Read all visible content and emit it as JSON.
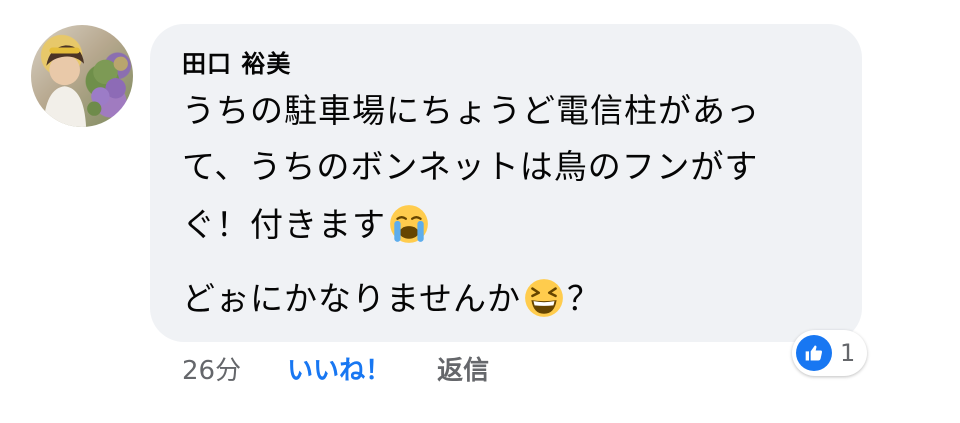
{
  "comment": {
    "author": "田口 裕美",
    "lines": {
      "l1": "うちの駐車場にちょうど電信柱があっ",
      "l2": "て、うちのボンネットは鳥のフンがす",
      "l3": "ぐ！付きます",
      "l4a": "どぉにかなりませんか",
      "l4b": "？"
    },
    "emoji_line3": "crying-face-emoji",
    "emoji_line4": "grinning-squinting-face-emoji",
    "time": "26分",
    "like_label": "いいね！",
    "reply_label": "返信",
    "reaction": {
      "icon": "thumbs-up-icon",
      "count": "1"
    }
  },
  "colors": {
    "bubble": "#f0f2f5",
    "like_blue": "#1877f2",
    "meta_gray": "#65676b",
    "text": "#050505"
  }
}
